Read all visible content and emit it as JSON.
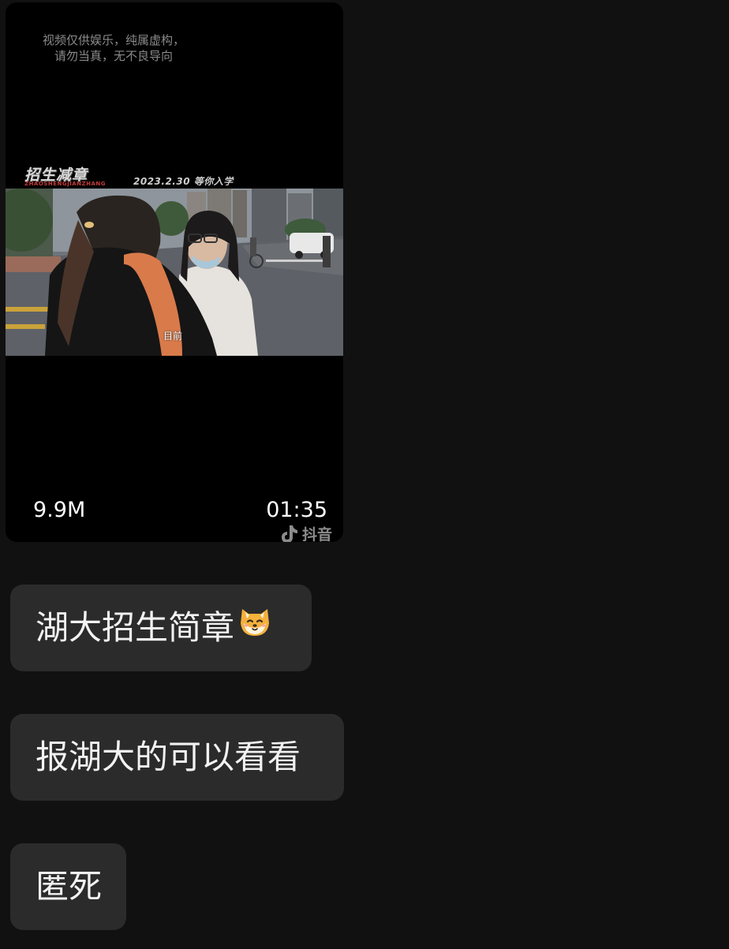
{
  "video": {
    "disclaimer_line1": "视频仅供娱乐，纯属虚构，",
    "disclaimer_line2": "请勿当真，无不良导向",
    "brand_title": "招生减章",
    "brand_subtitle": "ZHAOSHENGJIANZHANG",
    "brand_date": "2023.2.30 等你入学",
    "subtitle": "目前",
    "size": "9.9M",
    "duration": "01:35",
    "platform": "抖音",
    "platform_icon": "douyin-logo-icon"
  },
  "messages": [
    {
      "text": "湖大招生简章",
      "emoji": "shiba-dog-emoji"
    },
    {
      "text": "报湖大的可以看看"
    },
    {
      "text": "匿死"
    }
  ],
  "colors": {
    "background": "#111111",
    "bubble": "#2b2b2b",
    "text": "#f2f2f2"
  }
}
